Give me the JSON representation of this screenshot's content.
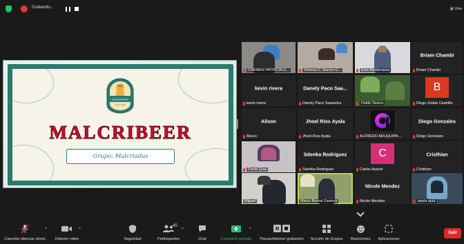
{
  "recording": {
    "label": "Grabando..."
  },
  "view": {
    "label": "Vista"
  },
  "presentation": {
    "main_title": "MALCRIBEER",
    "subtitle": "Grupo: Malcriadas",
    "logo_top": "ICG",
    "logo_text": "Golnquisibola",
    "logo_bottom": "Since 1 100"
  },
  "participants": [
    {
      "name": "CARMEN PATRICIA G...",
      "type": "cam",
      "muted": true
    },
    {
      "name": "Ximena C. Barrón G...",
      "type": "cam",
      "muted": true
    },
    {
      "name": "Emir Balderrama",
      "type": "cam",
      "muted": true
    },
    {
      "name": "Briam Chambi",
      "display": "Briam Chambi",
      "type": "name",
      "muted": true
    },
    {
      "name": "kevin rivera",
      "display": "kevin rivera",
      "type": "name",
      "muted": true
    },
    {
      "name": "Danely Paco Saavedra",
      "display": "Danely Paco Saa...",
      "type": "name",
      "muted": true
    },
    {
      "name": "Pablo Tavera",
      "type": "cam",
      "muted": true
    },
    {
      "name": "Diego Zulate Castrillo",
      "type": "avatar",
      "letter": "B",
      "color": "#d8391f",
      "muted": true
    },
    {
      "name": "Alison",
      "display": "Alison",
      "type": "name",
      "muted": true
    },
    {
      "name": "Jhoel Rios Ayala",
      "display": "Jhoel Rios Ayala",
      "type": "name",
      "muted": true
    },
    {
      "name": "ALFREDO ARUQUIPA ...",
      "type": "logo",
      "muted": true
    },
    {
      "name": "Diego Gonzales",
      "display": "Diego Gonzales",
      "type": "name",
      "muted": true
    },
    {
      "name": "Paola Quia",
      "type": "cam",
      "muted": true
    },
    {
      "name": "Sdenka Rodriguez",
      "display": "Sdenka Rodriguez",
      "type": "name",
      "muted": true
    },
    {
      "name": "Carlos Ayaviri",
      "type": "avatar",
      "letter": "C",
      "color": "#d62e77",
      "muted": true
    },
    {
      "name": "Cristhian",
      "display": "Cristhian",
      "type": "name",
      "muted": true
    },
    {
      "name": "Miguel",
      "type": "cam",
      "muted": false
    },
    {
      "name": "Marco Bernal Zamora",
      "type": "cam",
      "muted": false,
      "active": true
    },
    {
      "name": "Nicole Mendez",
      "display": "Nicole Mendez",
      "type": "name",
      "muted": true
    },
    {
      "name": "paola quia",
      "type": "cam",
      "muted": true
    }
  ],
  "toolbar": {
    "mute": "Cancelar silenciar ahora",
    "video": "Detener video",
    "security": "Seguridad",
    "participants": "Participantes",
    "participants_count": "45",
    "chat": "Chat",
    "share": "Compartir pantalla",
    "record": "Pausar/detener grabación",
    "breakout": "Sección de Grupos",
    "reactions": "Reacciones",
    "apps": "Aplicaciones",
    "leave": "Salir"
  },
  "colors": {
    "share_accent": "#2bb673",
    "active_speaker": "#b9d94a",
    "leave": "#e02828"
  }
}
